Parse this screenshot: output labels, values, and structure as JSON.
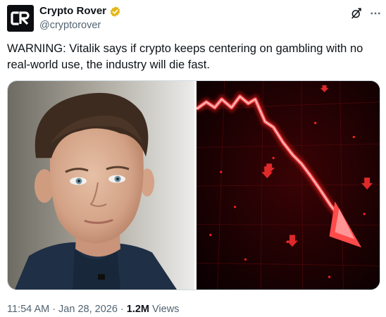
{
  "author": {
    "display_name": "Crypto Rover",
    "handle": "@cryptorover",
    "avatar_icon": "crypto-rover-logo-icon",
    "verified_icon": "gold-verified-badge-icon",
    "verified_color": "#e2b719"
  },
  "header_actions": {
    "grok_icon": "grok-icon",
    "more_icon": "more-options-icon"
  },
  "tweet": {
    "text": "WARNING: Vitalik says if crypto keeps centering on gambling with no real-world use, the industry will die fast."
  },
  "media": {
    "left_image": "portrait-photo",
    "right_image": "red-falling-chart-photo",
    "chart_color": "#ff2a2a"
  },
  "meta": {
    "time": "11:54 AM",
    "separator": "·",
    "date": "Jan 28, 2026",
    "views_count": "1.2M",
    "views_label": "Views"
  },
  "colors": {
    "text_primary": "#0f1419",
    "text_secondary": "#536471",
    "border": "#cfd9de"
  }
}
